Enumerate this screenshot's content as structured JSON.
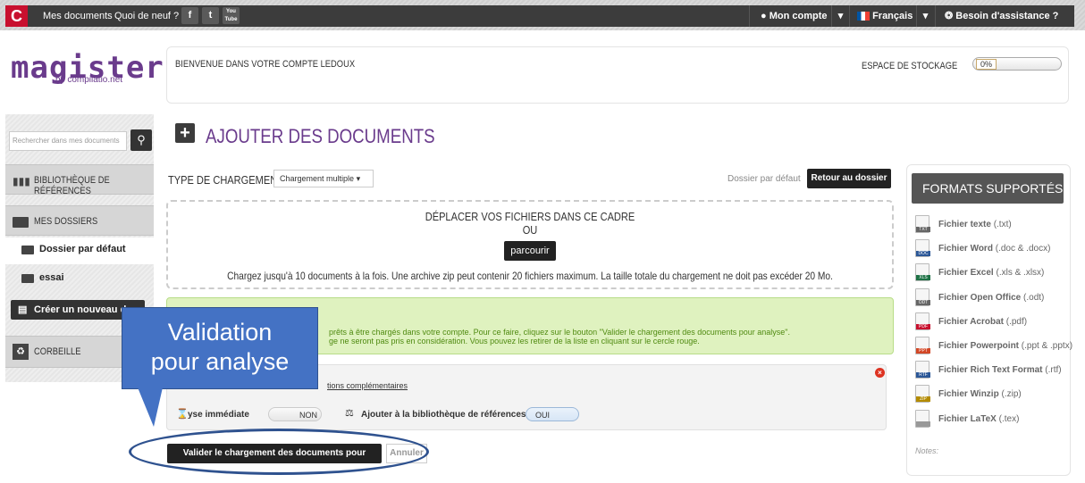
{
  "topbar": {
    "logo_letter": "C",
    "nav": [
      "Mes documents",
      "Quoi de neuf ?"
    ],
    "social": [
      "f",
      "t",
      "You Tube"
    ],
    "account": "Mon compte",
    "language": "Français",
    "help": "Besoin d'assistance ?"
  },
  "brand": {
    "name": "magister",
    "sub": "by compilatio.net",
    "color": "#6a3b8c"
  },
  "welcome": "BIENVENUE DANS VOTRE COMPTE LEDOUX",
  "storage": {
    "label": "ESPACE DE STOCKAGE",
    "percent": "0%",
    "fill": 0
  },
  "sidebar": {
    "search_placeholder": "Rechercher dans mes documents",
    "library": "Bibliothèque de références",
    "folders_title": "Mes dossiers",
    "folders": [
      "Dossier par défaut",
      "essai"
    ],
    "create_button": "Créer un nouveau do",
    "trash": "Corbeille"
  },
  "page": {
    "title": "AJOUTER DES DOCUMENTS",
    "type_label": "TYPE DE CHARGEMENT",
    "type_value": "Chargement multiple",
    "default_folder": "Dossier par défaut",
    "back_button": "Retour au dossier"
  },
  "dropzone": {
    "title": "DÉPLACER VOS FICHIERS DANS CE CADRE",
    "or": "OU",
    "browse": "parcourir",
    "info": "Chargez jusqu'à 10 documents à la fois. Une archive zip peut contenir 20 fichiers maximum. La taille totale du chargement ne doit pas excéder 20 Mo."
  },
  "notice": {
    "line1": "prêts à être chargés dans votre compte. Pour ce faire, cliquez sur le bouton \"Valider le chargement des documents pour analyse\".",
    "line2": "ge ne seront pas pris en considération. Vous pouvez les retirer de la liste en cliquant sur le cercle rouge."
  },
  "file_options": {
    "options_link": "tions complémentaires",
    "analysis_label": "yse immédiate",
    "analysis_value": "NON",
    "library_label": "Ajouter à la bibliothèque de références ?",
    "library_value": "OUI"
  },
  "actions": {
    "validate": "Valider le chargement des documents pour analyse",
    "cancel": "Annuler"
  },
  "formats": {
    "title": "FORMATS SUPPORTÉS",
    "items": [
      {
        "name": "Fichier texte",
        "ext": "(.txt)",
        "tag": "TXT",
        "color": "#666666"
      },
      {
        "name": "Fichier Word",
        "ext": "(.doc & .docx)",
        "tag": "DOC",
        "color": "#2b5797"
      },
      {
        "name": "Fichier Excel",
        "ext": "(.xls & .xlsx)",
        "tag": "XLS",
        "color": "#1e7145"
      },
      {
        "name": "Fichier Open Office",
        "ext": "(.odt)",
        "tag": "ODT",
        "color": "#666666"
      },
      {
        "name": "Fichier Acrobat",
        "ext": "(.pdf)",
        "tag": "PDF",
        "color": "#c8102e"
      },
      {
        "name": "Fichier Powerpoint",
        "ext": "(.ppt & .pptx)",
        "tag": "PPT",
        "color": "#d24726"
      },
      {
        "name": "Fichier Rich Text Format",
        "ext": "(.rtf)",
        "tag": "RTF",
        "color": "#2b5797"
      },
      {
        "name": "Fichier Winzip",
        "ext": "(.zip)",
        "tag": "ZIP",
        "color": "#b38b00"
      },
      {
        "name": "Fichier LaTeX",
        "ext": "(.tex)",
        "tag": "",
        "color": "#999999"
      }
    ],
    "notes": "Notes:"
  },
  "annotation": {
    "callout_line1": "Validation",
    "callout_line2": "pour analyse"
  }
}
